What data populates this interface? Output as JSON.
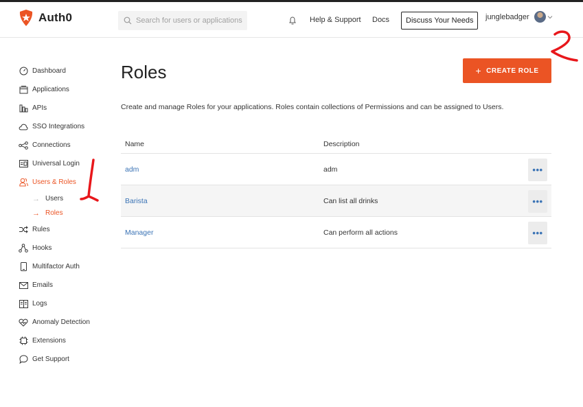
{
  "header": {
    "brand": "Auth0",
    "search_placeholder": "Search for users or applications",
    "help": "Help & Support",
    "docs": "Docs",
    "discuss": "Discuss Your Needs",
    "username": "junglebadger"
  },
  "sidebar": {
    "items": [
      {
        "label": "Dashboard",
        "icon": "dashboard-icon"
      },
      {
        "label": "Applications",
        "icon": "applications-icon"
      },
      {
        "label": "APIs",
        "icon": "apis-icon"
      },
      {
        "label": "SSO Integrations",
        "icon": "cloud-icon"
      },
      {
        "label": "Connections",
        "icon": "connections-icon"
      },
      {
        "label": "Universal Login",
        "icon": "universal-login-icon"
      },
      {
        "label": "Users & Roles",
        "icon": "users-icon"
      },
      {
        "label": "Rules",
        "icon": "rules-icon"
      },
      {
        "label": "Hooks",
        "icon": "hooks-icon"
      },
      {
        "label": "Multifactor Auth",
        "icon": "phone-icon"
      },
      {
        "label": "Emails",
        "icon": "email-icon"
      },
      {
        "label": "Logs",
        "icon": "logs-icon"
      },
      {
        "label": "Anomaly Detection",
        "icon": "heart-icon"
      },
      {
        "label": "Extensions",
        "icon": "extensions-icon"
      },
      {
        "label": "Get Support",
        "icon": "chat-icon"
      }
    ],
    "sub_items": [
      {
        "label": "Users"
      },
      {
        "label": "Roles"
      }
    ]
  },
  "main": {
    "title": "Roles",
    "create_button": "CREATE ROLE",
    "description": "Create and manage Roles for your applications. Roles contain collections of Permissions and can be assigned to Users.",
    "table": {
      "headers": [
        "Name",
        "Description"
      ],
      "rows": [
        {
          "name": "adm",
          "description": "adm"
        },
        {
          "name": "Barista",
          "description": "Can list all drinks"
        },
        {
          "name": "Manager",
          "description": "Can perform all actions"
        }
      ],
      "more_label": "•••"
    }
  },
  "colors": {
    "accent": "#eb5424",
    "link": "#3a73b5",
    "annotation": "#e8171b"
  }
}
